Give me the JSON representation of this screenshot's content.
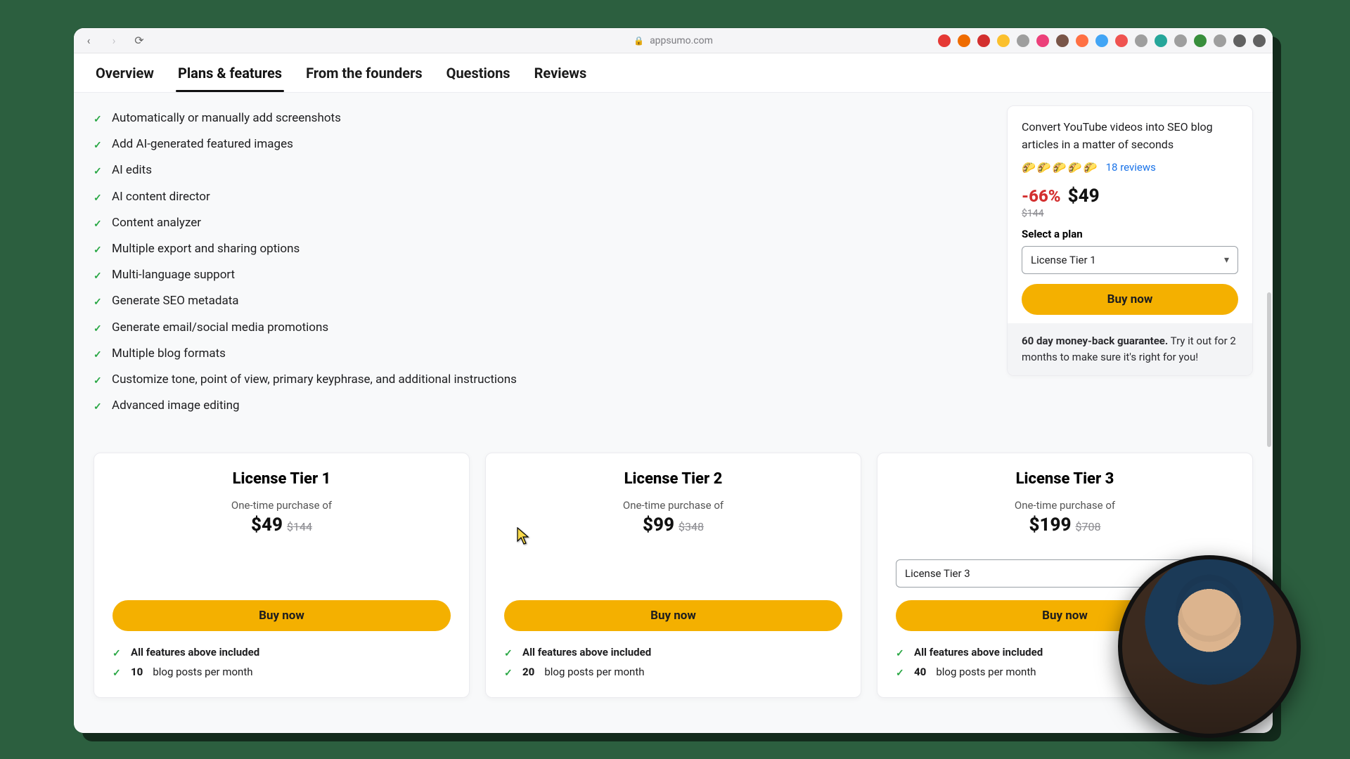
{
  "browser": {
    "domain": "appsumo.com",
    "extension_colors": [
      "#e53935",
      "#ef6c00",
      "#d32f2f",
      "#fbc02d",
      "#9e9e9e",
      "#ec407a",
      "#795548",
      "#ff7043",
      "#42a5f5",
      "#ef5350",
      "#9e9e9e",
      "#26a69a",
      "#9e9e9e",
      "#388e3c",
      "#9e9e9e",
      "#616161",
      "#616161"
    ]
  },
  "tabs": {
    "items": [
      {
        "label": "Overview"
      },
      {
        "label": "Plans & features"
      },
      {
        "label": "From the founders"
      },
      {
        "label": "Questions"
      },
      {
        "label": "Reviews"
      }
    ],
    "active_index": 1
  },
  "features": [
    "Automatically or manually add screenshots",
    "Add AI-generated featured images",
    "AI edits",
    "AI content director",
    "Content analyzer",
    "Multiple export and sharing options",
    "Multi-language support",
    "Generate SEO metadata",
    "Generate email/social media promotions",
    "Multiple blog formats",
    "Customize tone, point of view, primary keyphrase, and additional instructions",
    "Advanced image editing"
  ],
  "sidebar": {
    "description": "Convert YouTube videos into SEO blog articles in a matter of seconds",
    "rating_icons": "🌮🌮🌮🌮🌮",
    "reviews_text": "18 reviews",
    "discount": "-66%",
    "price": "$49",
    "original_price": "$144",
    "select_label": "Select a plan",
    "selected_plan": "License Tier 1",
    "buy_label": "Buy now",
    "guarantee_bold": "60 day money-back guarantee.",
    "guarantee_rest": " Try it out for 2 months to make sure it's right for you!"
  },
  "tiers": [
    {
      "title": "License Tier 1",
      "subtitle": "One-time purchase of",
      "price": "$49",
      "original": "$144",
      "has_select": false,
      "select_value": "",
      "buy_label": "Buy now",
      "included_label": "All features above included",
      "posts_count": "10",
      "posts_rest": " blog posts per month"
    },
    {
      "title": "License Tier 2",
      "subtitle": "One-time purchase of",
      "price": "$99",
      "original": "$348",
      "has_select": false,
      "select_value": "",
      "buy_label": "Buy now",
      "included_label": "All features above included",
      "posts_count": "20",
      "posts_rest": " blog posts per month"
    },
    {
      "title": "License Tier 3",
      "subtitle": "One-time purchase of",
      "price": "$199",
      "original": "$708",
      "has_select": true,
      "select_value": "License Tier 3",
      "buy_label": "Buy now",
      "included_label": "All features above included",
      "posts_count": "40",
      "posts_rest": " blog posts per month"
    }
  ]
}
